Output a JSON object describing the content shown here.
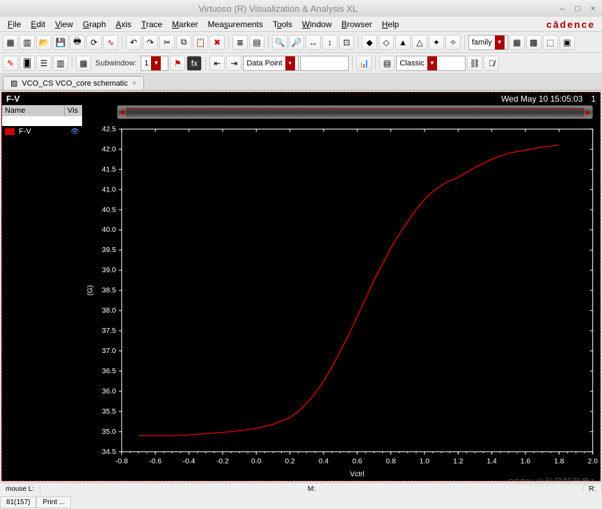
{
  "window": {
    "title": "Virtuoso (R) Visualization & Analysis XL"
  },
  "brand": "cādence",
  "menus": [
    "File",
    "Edit",
    "View",
    "Graph",
    "Axis",
    "Trace",
    "Marker",
    "Measurements",
    "Tools",
    "Window",
    "Browser",
    "Help"
  ],
  "toolbar2": {
    "subwindow_label": "Subwindow:",
    "subwindow_value": "1",
    "datapoint_label": "Data Point",
    "datapoint_value": "",
    "family_label": "family",
    "classic_label": "Classic"
  },
  "tab": {
    "label": "VCO_CS VCO_core schematic"
  },
  "plot": {
    "title": "F-V",
    "timestamp": "Wed May 10 15:05:03",
    "index": "1",
    "legend_name": "Name",
    "legend_vis": "Vis",
    "series_name": "F-V"
  },
  "status": {
    "mouseL": "mouse L:",
    "M": "M:",
    "R": "R:",
    "left": "81(157)",
    "print": "Print ..."
  },
  "watermark": "CSDN @秋风知我意1",
  "chart_data": {
    "type": "line",
    "title": "F-V",
    "xlabel": "Vctrl",
    "ylabel": "(G)",
    "xlim": [
      -0.8,
      2.0
    ],
    "ylim": [
      34.5,
      42.5
    ],
    "xticks": [
      -0.8,
      -0.6,
      -0.4,
      -0.2,
      0.0,
      0.2,
      0.4,
      0.6,
      0.8,
      1.0,
      1.2,
      1.4,
      1.6,
      1.8,
      2.0
    ],
    "yticks": [
      34.5,
      35.0,
      35.5,
      36.0,
      36.5,
      37.0,
      37.5,
      38.0,
      38.5,
      39.0,
      39.5,
      40.0,
      40.5,
      41.0,
      41.5,
      42.0,
      42.5
    ],
    "series": [
      {
        "name": "F-V",
        "color": "#cc0000",
        "x": [
          -0.7,
          -0.6,
          -0.5,
          -0.4,
          -0.3,
          -0.2,
          -0.1,
          0.0,
          0.1,
          0.2,
          0.25,
          0.3,
          0.35,
          0.4,
          0.45,
          0.5,
          0.55,
          0.6,
          0.65,
          0.7,
          0.75,
          0.8,
          0.85,
          0.9,
          0.95,
          1.0,
          1.05,
          1.1,
          1.15,
          1.2,
          1.3,
          1.4,
          1.5,
          1.6,
          1.7,
          1.8
        ],
        "y": [
          34.9,
          34.9,
          34.9,
          34.92,
          34.95,
          34.98,
          35.02,
          35.08,
          35.18,
          35.35,
          35.5,
          35.7,
          35.95,
          36.25,
          36.6,
          37.0,
          37.4,
          37.85,
          38.3,
          38.75,
          39.15,
          39.55,
          39.9,
          40.2,
          40.5,
          40.75,
          40.95,
          41.1,
          41.22,
          41.3,
          41.55,
          41.75,
          41.9,
          41.98,
          42.05,
          42.1
        ]
      }
    ]
  }
}
